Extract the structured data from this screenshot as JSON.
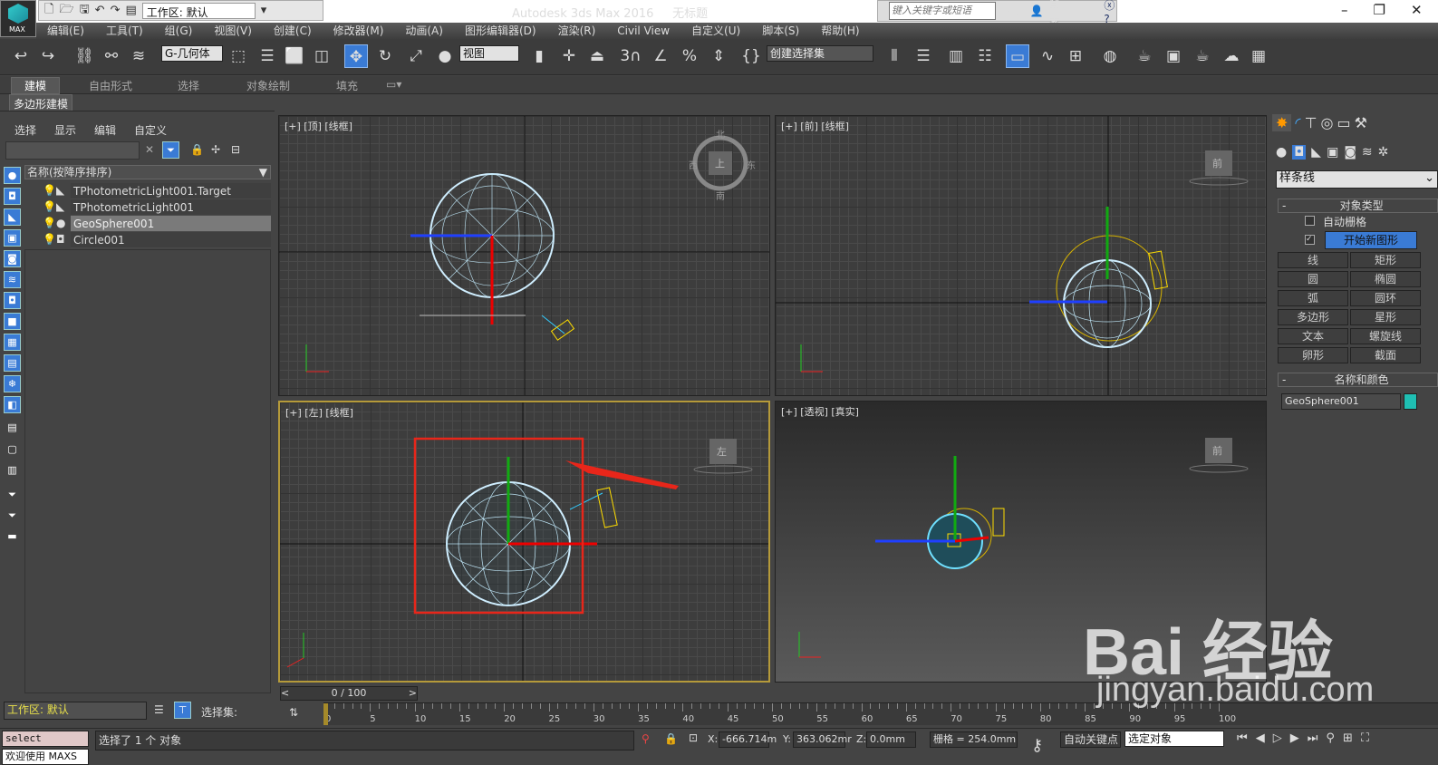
{
  "title": {
    "app": "Autodesk 3ds Max 2016",
    "doc": "无标题",
    "logo": "MAX",
    "workspace": "工作区: 默认",
    "search_placeholder": "键入关键字或短语",
    "login": "登录"
  },
  "menu": [
    "编辑(E)",
    "工具(T)",
    "组(G)",
    "视图(V)",
    "创建(C)",
    "修改器(M)",
    "动画(A)",
    "图形编辑器(D)",
    "渲染(R)",
    "Civil View",
    "自定义(U)",
    "脚本(S)",
    "帮助(H)"
  ],
  "toolbar": {
    "filter": "G-几何体",
    "ref_coord": "视图",
    "selection_set": "创建选择集",
    "snap_3": "3",
    "snap_pct": "%"
  },
  "ribbon": {
    "tabs": [
      "建模",
      "自由形式",
      "选择",
      "对象绘制",
      "填充"
    ],
    "active": "建模",
    "sub": "多边形建模"
  },
  "scene_explorer": {
    "menu": [
      "选择",
      "显示",
      "编辑",
      "自定义"
    ],
    "column": "名称(按降序排序)",
    "rows": [
      {
        "name": "TPhotometricLight001.Target",
        "selected": false
      },
      {
        "name": "TPhotometricLight001",
        "selected": false
      },
      {
        "name": "GeoSphere001",
        "selected": true
      },
      {
        "name": "Circle001",
        "selected": false
      }
    ]
  },
  "viewports": [
    {
      "label": "[+] [顶] [线框]",
      "cube": "上",
      "compass": [
        "北",
        "西",
        "东",
        "南"
      ]
    },
    {
      "label": "[+] [前] [线框]",
      "cube": "前"
    },
    {
      "label": "[+] [左] [线框]",
      "cube": "左"
    },
    {
      "label": "[+] [透视] [真实]",
      "cube": "前"
    }
  ],
  "command_panel": {
    "category": "样条线",
    "rollout1": "对象类型",
    "auto_grid": "自动栅格",
    "start_new_shape": "开始新图形",
    "auto_grid_checked": false,
    "start_new_checked": true,
    "buttons": [
      "线",
      "矩形",
      "圆",
      "椭圆",
      "弧",
      "圆环",
      "多边形",
      "星形",
      "文本",
      "螺旋线",
      "卵形",
      "截面"
    ],
    "rollout2": "名称和颜色",
    "object_name": "GeoSphere001",
    "object_color": "#1fbfb3"
  },
  "left_bottom": {
    "workspace": "工作区: 默认",
    "selection_set": "选择集:"
  },
  "timeline": {
    "frame": "0 / 100",
    "ticks": [
      "0",
      "5",
      "10",
      "15",
      "20",
      "25",
      "30",
      "35",
      "40",
      "45",
      "50",
      "55",
      "60",
      "65",
      "70",
      "75",
      "80",
      "85",
      "90",
      "95",
      "100"
    ]
  },
  "status": {
    "script": "select $GeoSph",
    "welcome": "欢迎使用 MAXS",
    "message": "选择了 1 个 对象",
    "x": "-666.714m",
    "y": "363.062mr",
    "z": "0.0mm",
    "grid": "栅格 = 254.0mm",
    "auto_key": "自动关键点",
    "key_filter": "选定对象",
    "x_lbl": "X:",
    "y_lbl": "Y:",
    "z_lbl": "Z:"
  },
  "watermark": {
    "brand": "Bai 经验",
    "url": "jingyan.baidu.com"
  }
}
